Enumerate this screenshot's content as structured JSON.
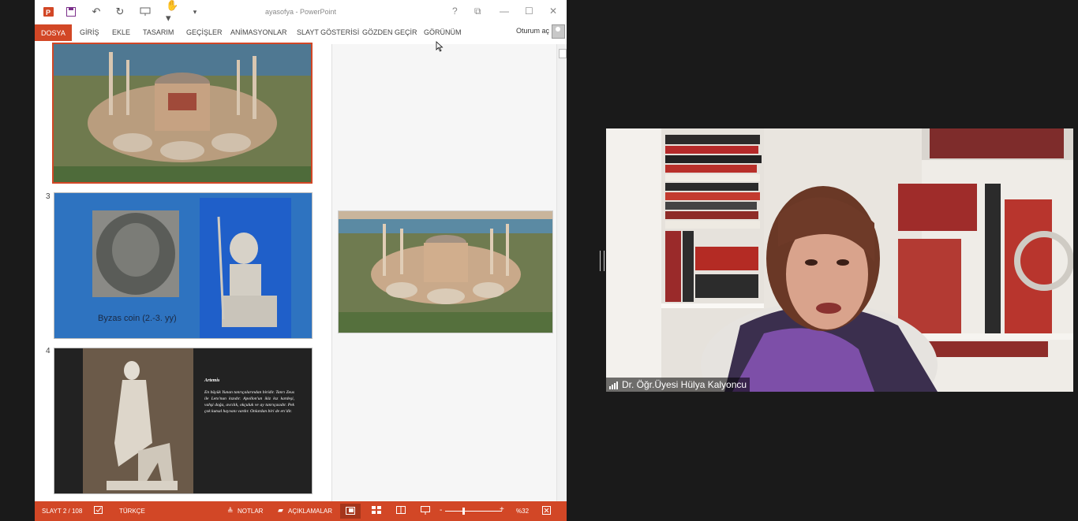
{
  "window": {
    "title": "ayasofya - PowerPoint",
    "help": "?",
    "controls": [
      "⧉",
      "—",
      "☐",
      "✕"
    ]
  },
  "quick_access": {
    "icons": [
      "powerpoint-logo-icon",
      "save-icon",
      "undo-icon",
      "redo-icon",
      "present-icon",
      "touch-mode-icon",
      "customize-icon"
    ]
  },
  "ribbon": {
    "tabs": [
      "DOSYA",
      "GİRİŞ",
      "EKLE",
      "TASARIM",
      "GEÇİŞLER",
      "ANİMASYONLAR",
      "SLAYT GÖSTERİSİ",
      "GÖZDEN GEÇİR",
      "GÖRÜNÜM"
    ],
    "signin": "Oturum aç"
  },
  "thumbnails": [
    {
      "number": "",
      "kind": "aerial-photo"
    },
    {
      "number": "3",
      "kind": "coin-and-statue",
      "caption": "Byzas coin (2.-3. yy)"
    },
    {
      "number": "4",
      "kind": "artemis",
      "title": "Artemis",
      "body": "En büyük Yunan tanrıçalarından biridir. Tanrı Zeus ile Leto'nun kızıdır. Apollon'un ikiz kız kardeşi, vahşi doğa, avcılık, okçuluk ve ay tanrıçasıdır. Pek çok kutsal hayvanı vardır. Onlardan biri de erı'dir."
    }
  ],
  "status": {
    "slide": "SLAYT 2 / 108",
    "language": "TÜRKÇE",
    "notes": "NOTLAR",
    "comments": "AÇIKLAMALAR",
    "zoom": "%32",
    "zoom_level": 0.32
  },
  "video": {
    "participant": "Dr. Öğr.Üyesi Hülya Kalyoncu"
  },
  "colors": {
    "accent": "#d24726",
    "slide_blue": "#2e73c0"
  }
}
